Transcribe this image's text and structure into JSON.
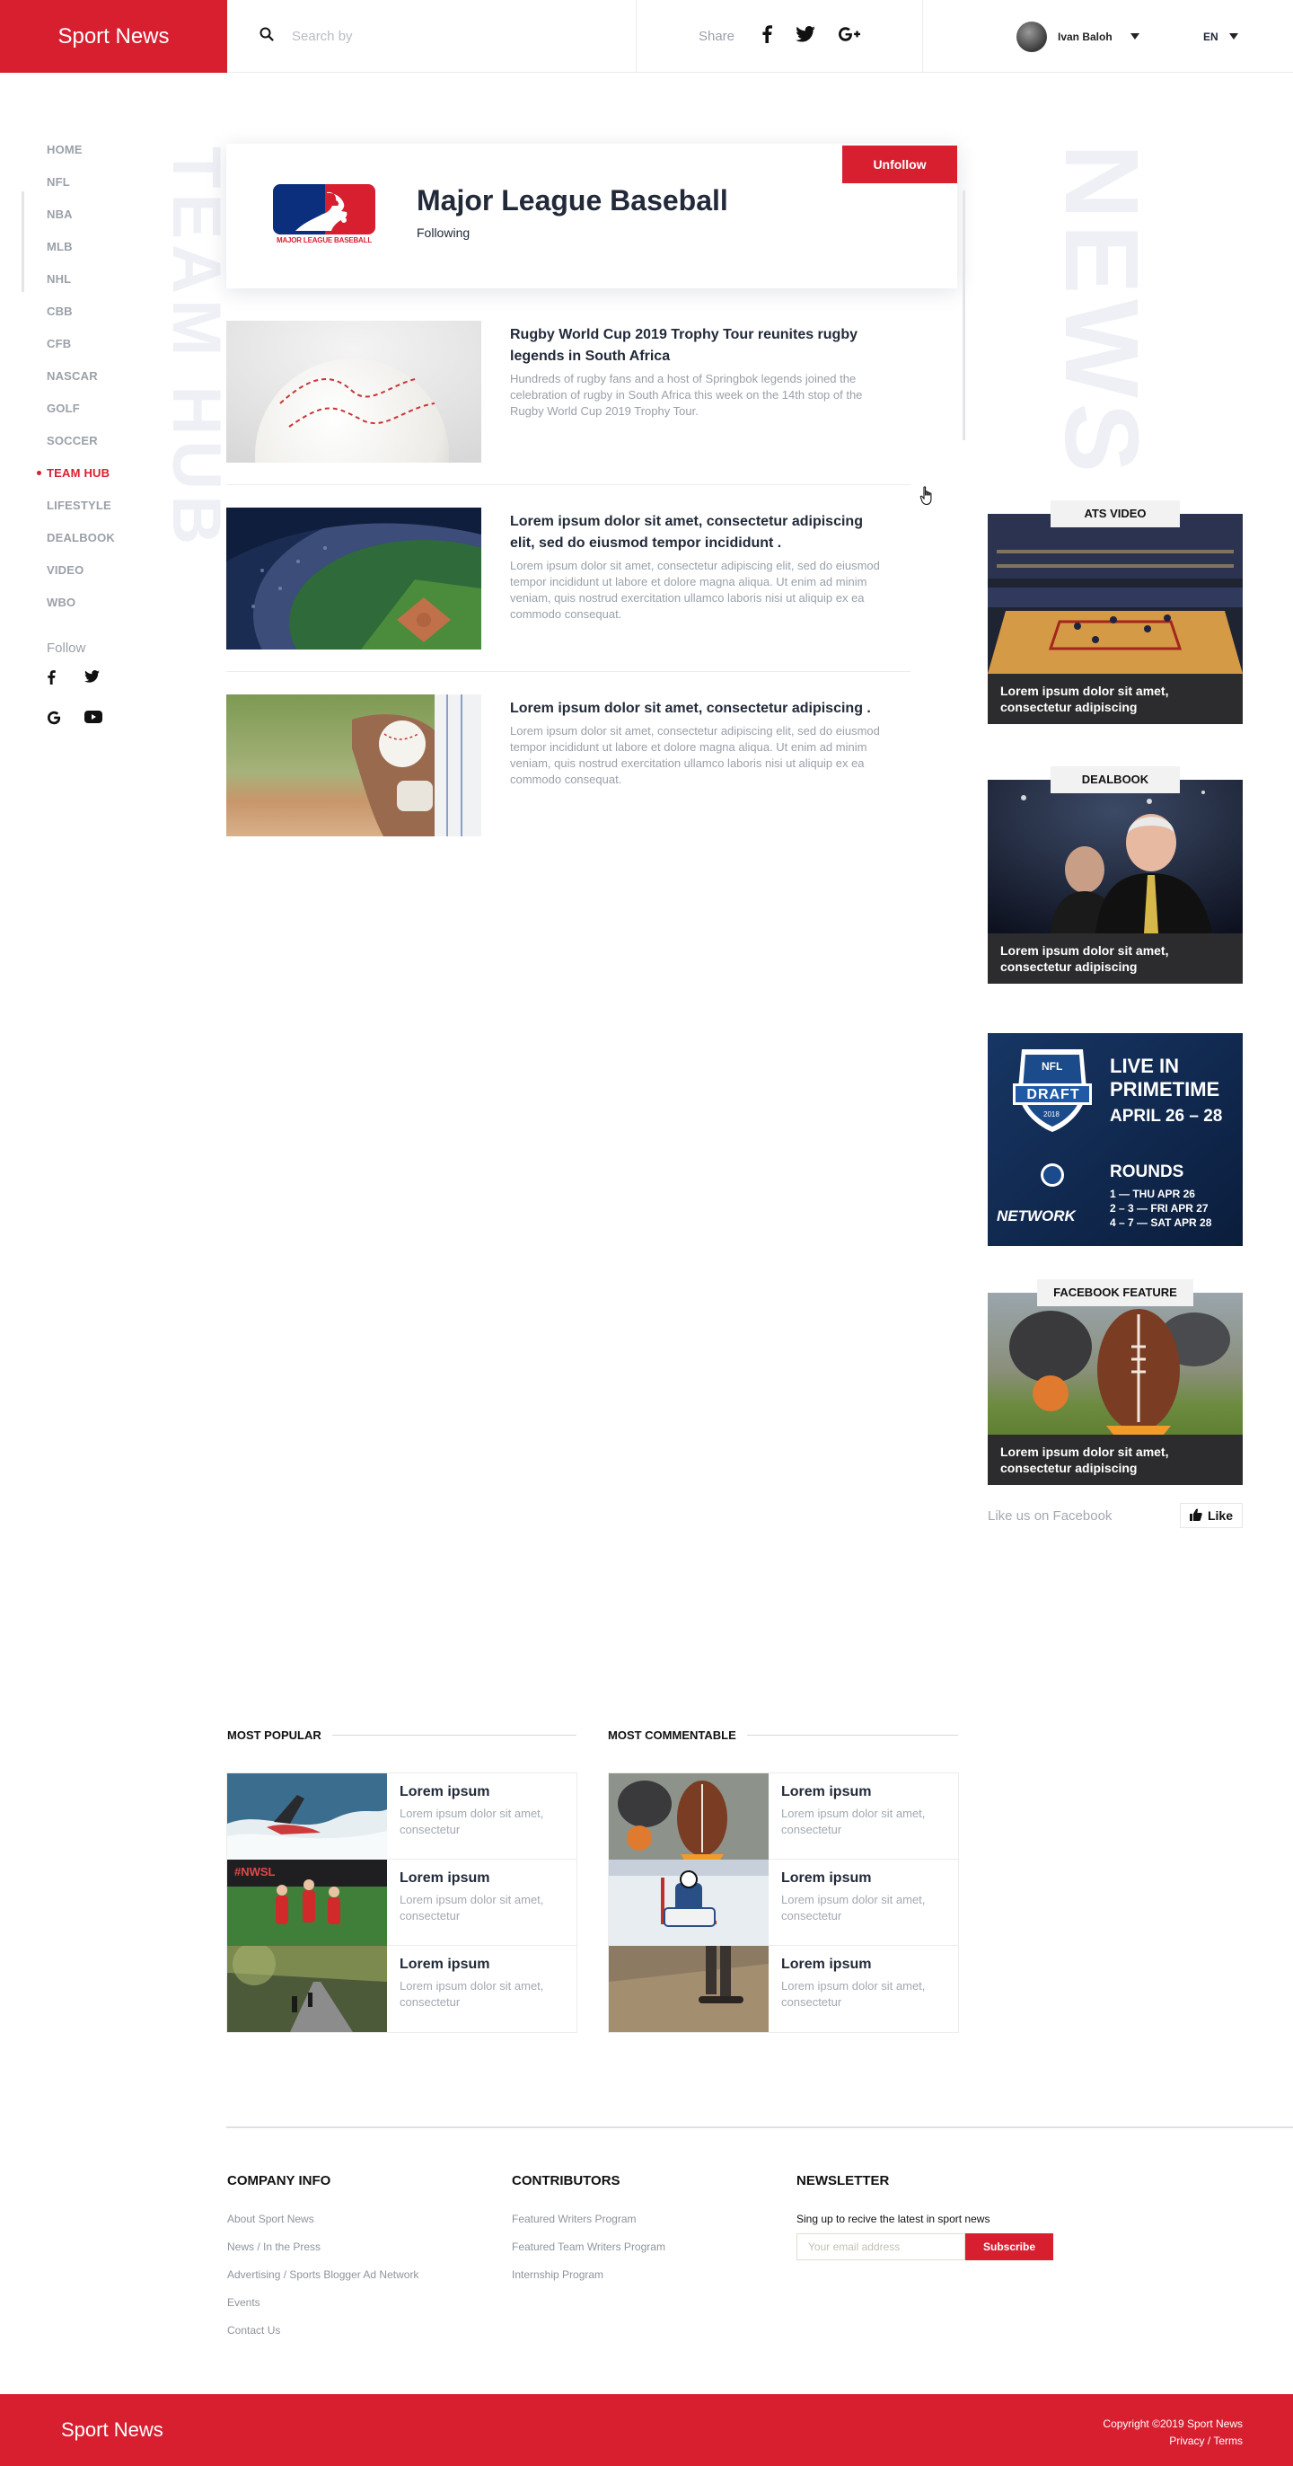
{
  "header": {
    "brand": "Sport News",
    "search_placeholder": "Search by",
    "share_label": "Share",
    "user_name": "Ivan Baloh",
    "language": "EN"
  },
  "sidebar": {
    "items": [
      {
        "label": "HOME"
      },
      {
        "label": "NFL"
      },
      {
        "label": "NBA"
      },
      {
        "label": "MLB"
      },
      {
        "label": "NHL"
      },
      {
        "label": "CBB"
      },
      {
        "label": "CFB"
      },
      {
        "label": "NASCAR"
      },
      {
        "label": "GOLF"
      },
      {
        "label": "SOCCER"
      },
      {
        "label": "TEAM HUB",
        "active": true
      },
      {
        "label": "LIFESTYLE"
      },
      {
        "label": "DEALBOOK"
      },
      {
        "label": "VIDEO"
      },
      {
        "label": "WBO"
      }
    ],
    "follow_label": "Follow",
    "vertical_left": "TEAM HUB",
    "vertical_right": "NEWS"
  },
  "team": {
    "name": "Major League Baseball",
    "status": "Following",
    "unfollow_label": "Unfollow",
    "logo_text": "MAJOR LEAGUE BASEBALL"
  },
  "articles": [
    {
      "title": "Rugby World Cup 2019 Trophy Tour reunites rugby legends in South Africa",
      "body": "Hundreds of rugby fans and a host of Springbok legends joined the celebration of rugby in South Africa this week on the 14th stop of the Rugby World Cup 2019 Trophy Tour."
    },
    {
      "title": "Lorem ipsum dolor sit amet, consectetur adipiscing elit, sed do eiusmod tempor incididunt .",
      "body": "Lorem ipsum dolor sit amet, consectetur adipiscing elit, sed do eiusmod tempor incididunt ut labore et dolore magna aliqua. Ut enim ad minim veniam, quis nostrud exercitation ullamco laboris nisi ut aliquip ex ea commodo consequat."
    },
    {
      "title": "Lorem ipsum dolor sit amet, consectetur adipiscing .",
      "body": "Lorem ipsum dolor sit amet, consectetur adipiscing elit, sed do eiusmod tempor incididunt ut labore et dolore magna aliqua. Ut enim ad minim veniam, quis nostrud exercitation ullamco laboris nisi ut aliquip ex ea commodo consequat."
    }
  ],
  "widgets": {
    "ats_video": {
      "tag": "ATS VIDEO",
      "caption": "Lorem ipsum dolor sit amet, consectetur adipiscing"
    },
    "dealbook": {
      "tag": "DEALBOOK",
      "caption": "Lorem ipsum dolor sit amet, consectetur adipiscing"
    },
    "ad": {
      "badge_top": "NFL",
      "badge": "DRAFT",
      "badge_year": "2018",
      "headline1": "LIVE IN",
      "headline2": "PRIMETIME",
      "dates": "APRIL 26 – 28",
      "rounds_label": "ROUNDS",
      "round1": "1 — THU APR 26",
      "round2": "2 – 3 — FRI APR 27",
      "round3": "4 – 7 — SAT APR 28",
      "network": "NETWORK"
    },
    "facebook": {
      "tag": "FACEBOOK FEATURE",
      "caption": "Lorem ipsum dolor sit amet, consectetur adipiscing"
    },
    "like_text": "Like us on Facebook",
    "like_button": "Like"
  },
  "most_popular": {
    "heading": "MOST POPULAR",
    "items": [
      {
        "title": "Lorem ipsum",
        "sub": "Lorem ipsum dolor sit amet, consectetur",
        "img_text": ""
      },
      {
        "title": "Lorem ipsum",
        "sub": "Lorem ipsum dolor sit amet, consectetur",
        "img_text": "#NWSL"
      },
      {
        "title": "Lorem ipsum",
        "sub": "Lorem ipsum dolor sit amet, consectetur",
        "img_text": ""
      }
    ]
  },
  "most_commentable": {
    "heading": "MOST COMMENTABLE",
    "items": [
      {
        "title": "Lorem ipsum",
        "sub": "Lorem ipsum dolor sit amet, consectetur"
      },
      {
        "title": "Lorem ipsum",
        "sub": "Lorem ipsum dolor sit amet, consectetur"
      },
      {
        "title": "Lorem ipsum",
        "sub": "Lorem ipsum dolor sit amet, consectetur"
      }
    ]
  },
  "footer": {
    "company": {
      "heading": "COMPANY INFO",
      "links": [
        "About Sport News",
        "News / In the Press",
        "Advertising / Sports Blogger Ad Network",
        "Events",
        "Contact Us"
      ]
    },
    "contributors": {
      "heading": "CONTRIBUTORS",
      "links": [
        "Featured Writers Program",
        "Featured Team Writers Program",
        "Internship Program"
      ]
    },
    "newsletter": {
      "heading": "NEWSLETTER",
      "text": "Sing up to recive the latest in sport news",
      "placeholder": "Your email address",
      "button": "Subscribe"
    },
    "brand": "Sport News",
    "copyright": "Copyright ©2019 Sport News",
    "legal": "Privacy / Terms"
  },
  "colors": {
    "accent": "#d71f30",
    "dark_widget": "#2c2c2e",
    "ad_navy": "#0f2647"
  },
  "icons": [
    "search-icon",
    "facebook-icon",
    "twitter-icon",
    "google-plus-icon",
    "google-icon",
    "youtube-icon",
    "thumbs-up-icon",
    "hand-cursor-icon"
  ]
}
